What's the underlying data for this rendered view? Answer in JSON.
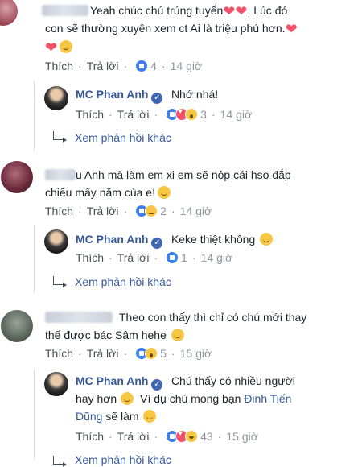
{
  "comments": [
    {
      "text": "Yeah chúc chú trúng tuyển",
      "text2": ". Lúc đó",
      "line2": "con sẽ thường xuyên xem ct Ai là triệu phú hơn.",
      "actions": {
        "like": "Thích",
        "reply": "Trả lời",
        "count": "4",
        "time": "14 giờ"
      },
      "reply": {
        "author": "MC Phan Anh",
        "text": "Nhớ nhá!",
        "actions": {
          "like": "Thích",
          "reply": "Trả lời",
          "count": "3",
          "time": "14 giờ"
        }
      },
      "more": "Xem phản hồi khác"
    },
    {
      "text": "u Anh mà làm em xi em sẽ nộp cái hso đắp",
      "line2": "chiếu mấy năm của e!",
      "actions": {
        "like": "Thích",
        "reply": "Trả lời",
        "count": "2",
        "time": "14 giờ"
      },
      "reply": {
        "author": "MC Phan Anh",
        "text": "Keke thiệt không",
        "actions": {
          "like": "Thích",
          "reply": "Trả lời",
          "count": "1",
          "time": "14 giờ"
        }
      },
      "more": "Xem phản hồi khác"
    },
    {
      "text": "Theo con thấy thì chỉ có chú mới thay",
      "line2": "thế được bác Sâm hehe",
      "actions": {
        "like": "Thích",
        "reply": "Trả lời",
        "count": "5",
        "time": "15 giờ"
      },
      "reply": {
        "author": "MC Phan Anh",
        "text": "Chú thấy có nhiều người",
        "line2": "hay hơn",
        "line2b": "Ví dụ chú mong bạn",
        "mention": "Đinh Tiến",
        "line3a": "Dũng",
        "line3b": "sẽ làm",
        "actions": {
          "like": "Thích",
          "reply": "Trả lời",
          "count": "43",
          "time": "15 giờ"
        }
      },
      "more": "Xem phản hồi khác"
    }
  ]
}
